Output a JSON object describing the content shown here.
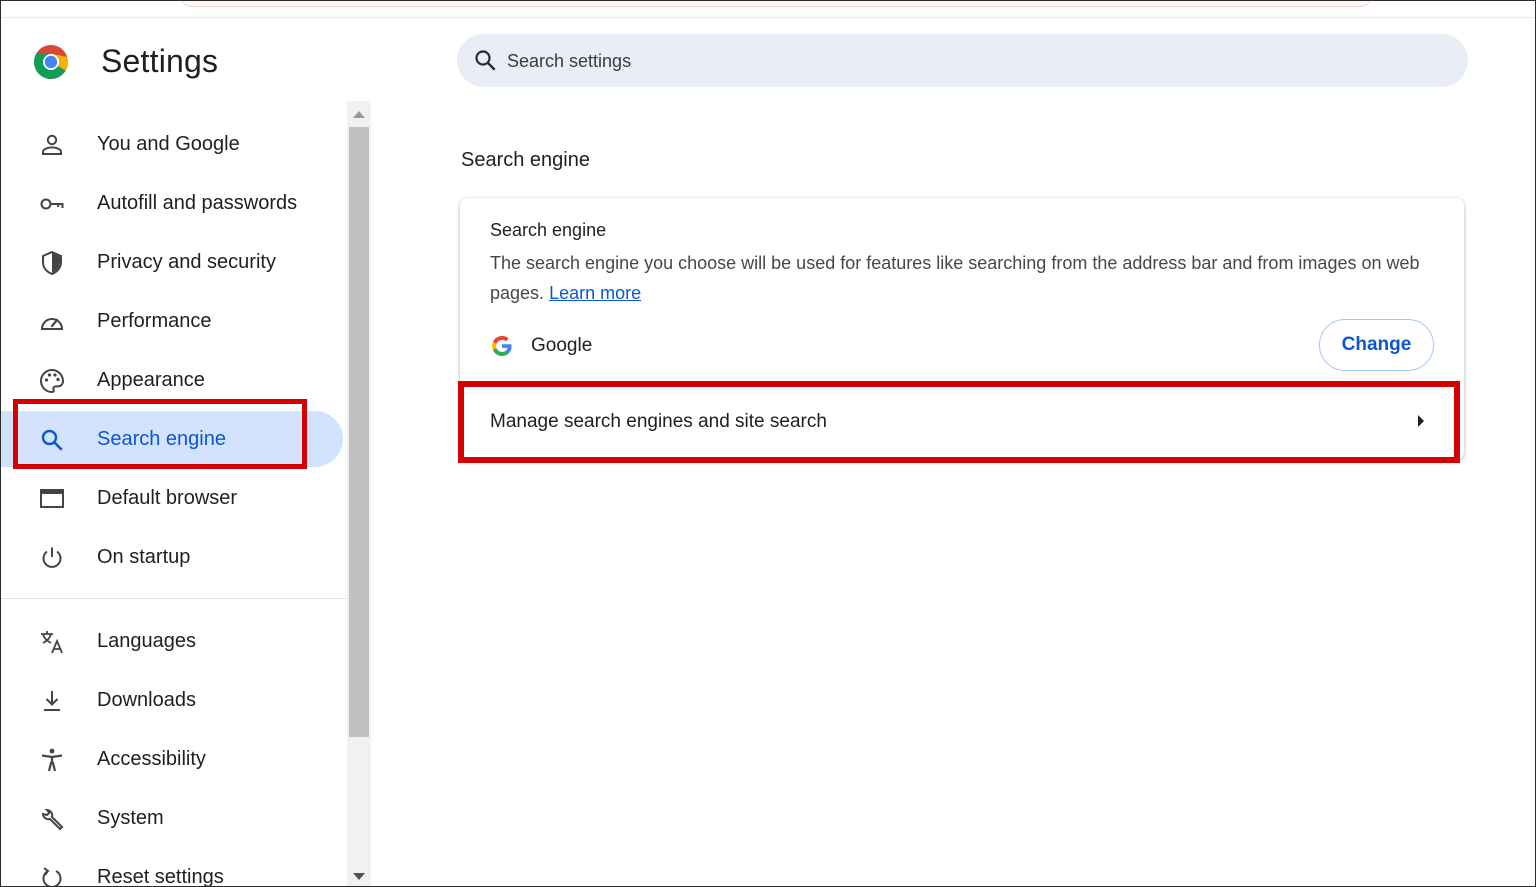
{
  "header": {
    "title": "Settings",
    "search_placeholder": "Search settings"
  },
  "sidebar": {
    "items": [
      {
        "label": "You and Google",
        "icon": "person-icon"
      },
      {
        "label": "Autofill and passwords",
        "icon": "key-icon"
      },
      {
        "label": "Privacy and security",
        "icon": "shield-icon"
      },
      {
        "label": "Performance",
        "icon": "speedometer-icon"
      },
      {
        "label": "Appearance",
        "icon": "palette-icon"
      },
      {
        "label": "Search engine",
        "icon": "search-icon",
        "active": true
      },
      {
        "label": "Default browser",
        "icon": "browser-window-icon"
      },
      {
        "label": "On startup",
        "icon": "power-icon"
      },
      {
        "label": "Languages",
        "icon": "translate-icon"
      },
      {
        "label": "Downloads",
        "icon": "download-icon"
      },
      {
        "label": "Accessibility",
        "icon": "accessibility-icon"
      },
      {
        "label": "System",
        "icon": "wrench-icon"
      },
      {
        "label": "Reset settings",
        "icon": "reset-icon"
      }
    ]
  },
  "main": {
    "section_title": "Search engine",
    "card": {
      "heading": "Search engine",
      "description": "The search engine you choose will be used for features like searching from the address bar and from images on web pages.",
      "learn_more": "Learn more",
      "current_engine": "Google",
      "change_button": "Change",
      "manage_label": "Manage search engines and site search"
    }
  },
  "colors": {
    "accent": "#0b57d0",
    "active_bg": "#d3e3fd",
    "highlight_box": "#d50000",
    "search_bg": "#e9eef6"
  }
}
